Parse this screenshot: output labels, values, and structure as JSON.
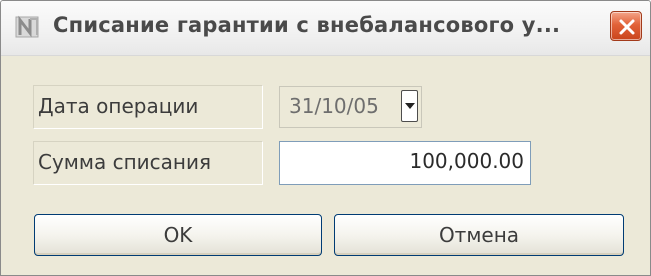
{
  "window": {
    "title": "Списание гарантии с внебалансового у...",
    "app_icon": "app-logo-icon",
    "close_icon": "close-icon"
  },
  "form": {
    "operation_date": {
      "label": "Дата операции",
      "value": "31/10/05",
      "dropdown_icon": "chevron-down-icon"
    },
    "writeoff_amount": {
      "label": "Сумма списания",
      "value": "100,000.00"
    }
  },
  "buttons": {
    "ok_label": "OK",
    "cancel_label": "Отмена"
  },
  "colors": {
    "dialog_background": "#ece9d8",
    "close_button": "#e26238",
    "button_border": "#003c74",
    "field_border": "#7f9db9"
  }
}
